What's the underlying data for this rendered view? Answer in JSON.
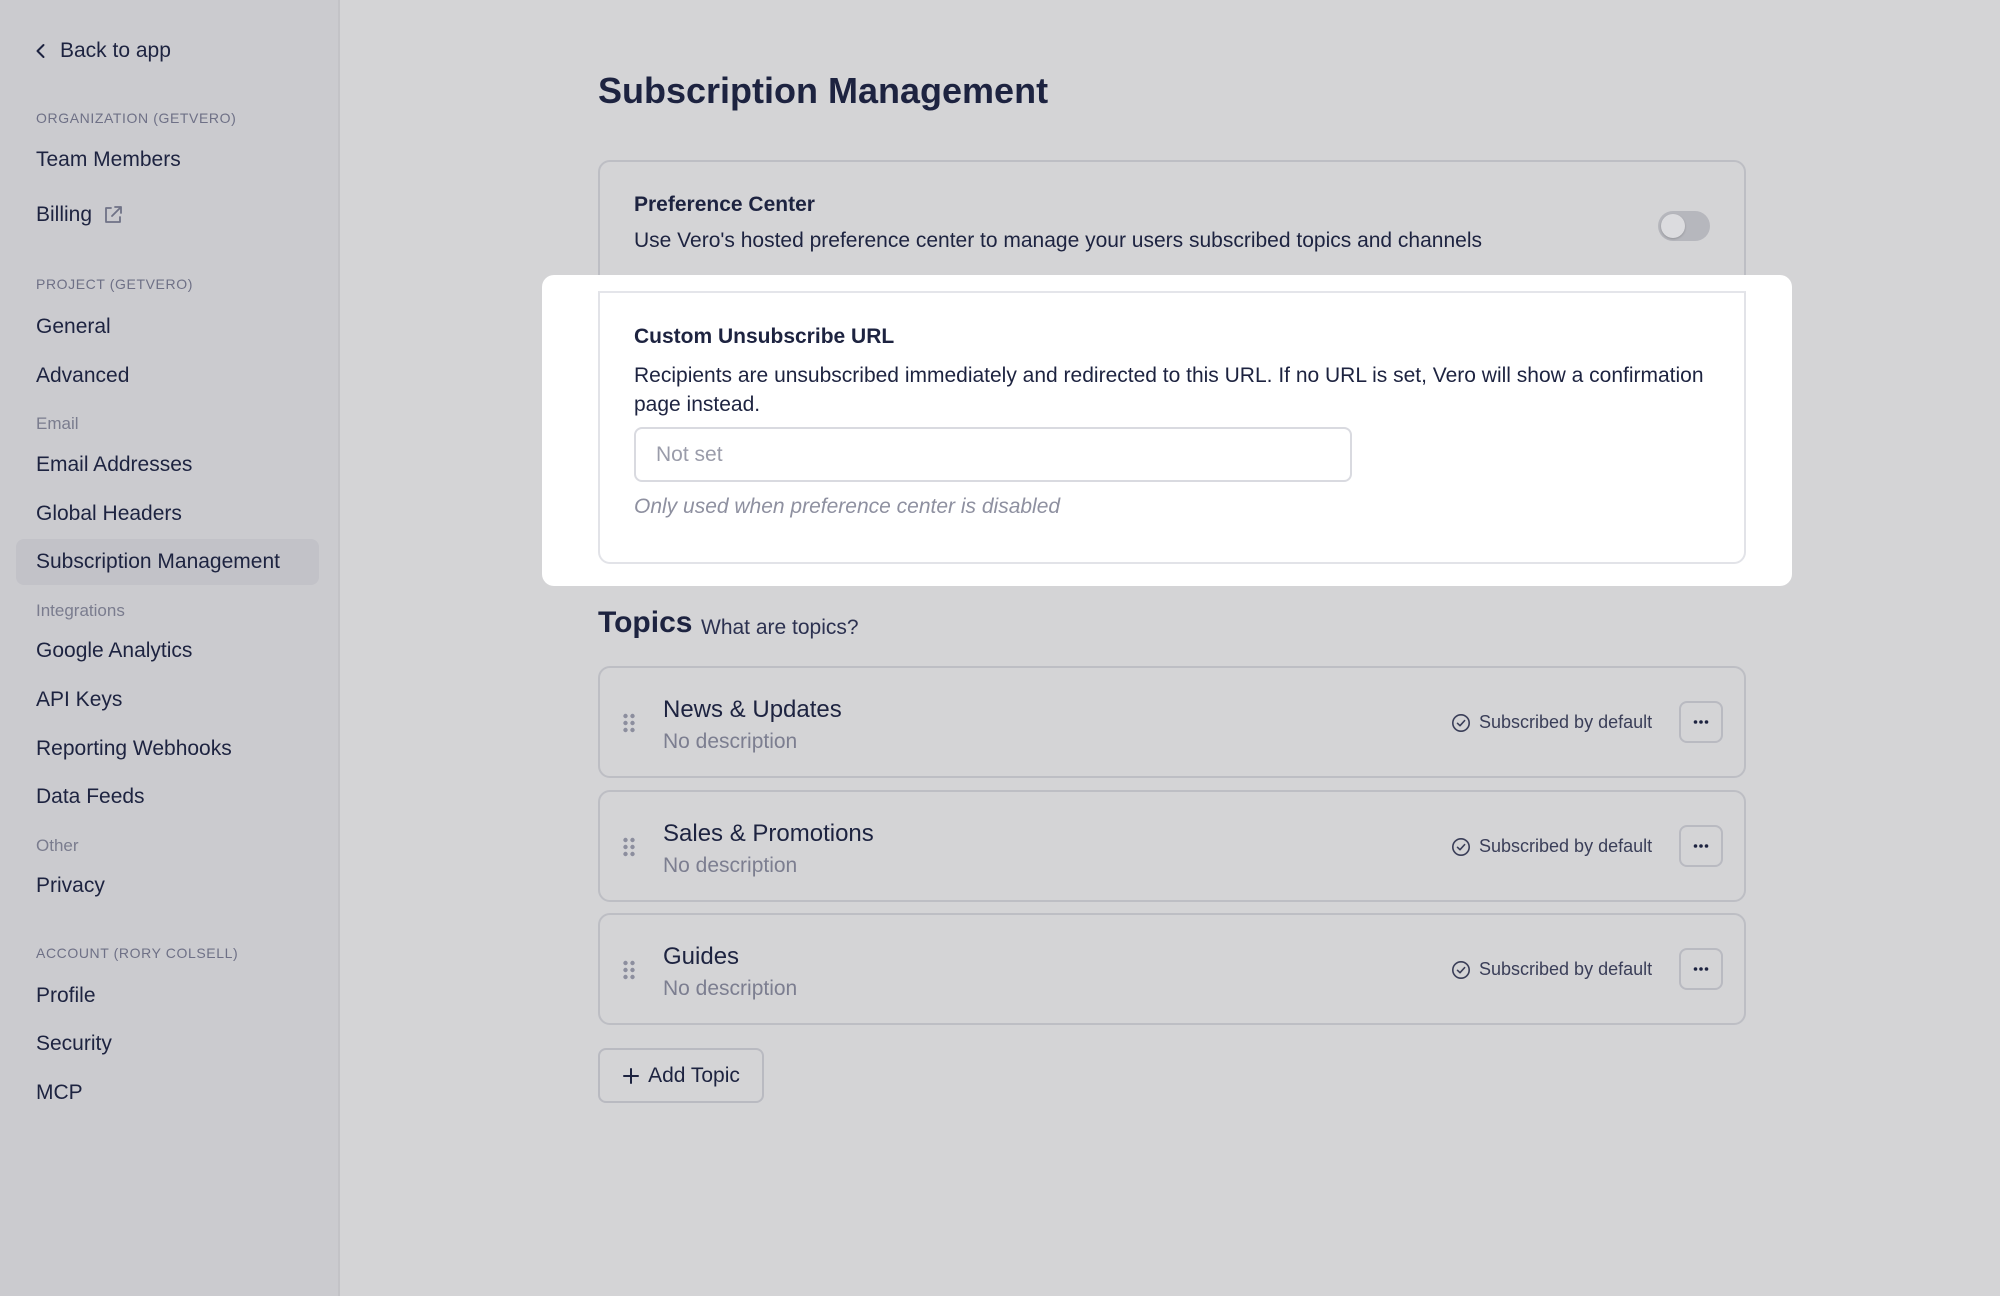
{
  "sidebar": {
    "back_label": "Back to app",
    "sections": {
      "organization": "ORGANIZATION (GETVERO)",
      "project": "PROJECT (GETVERO)",
      "email": "Email",
      "integrations": "Integrations",
      "other": "Other",
      "account": "ACCOUNT (RORY COLSELL)"
    },
    "items": {
      "team_members": "Team Members",
      "billing": "Billing",
      "general": "General",
      "advanced": "Advanced",
      "email_addresses": "Email Addresses",
      "global_headers": "Global Headers",
      "subscription_management": "Subscription Management",
      "google_analytics": "Google Analytics",
      "api_keys": "API Keys",
      "reporting_webhooks": "Reporting Webhooks",
      "data_feeds": "Data Feeds",
      "privacy": "Privacy",
      "profile": "Profile",
      "security": "Security",
      "mcp": "MCP"
    },
    "active_item": "Subscription Management"
  },
  "main": {
    "title": "Subscription Management",
    "preference_center": {
      "title": "Preference Center",
      "description": "Use Vero's hosted preference center to manage your users subscribed topics and channels",
      "enabled": false
    },
    "custom_unsubscribe": {
      "title": "Custom Unsubscribe URL",
      "description": "Recipients are unsubscribed immediately and redirected to this URL. If no URL is set, Vero will show a confirmation page instead.",
      "value": "",
      "placeholder": "Not set",
      "hint": "Only used when preference center is disabled"
    },
    "topics": {
      "heading": "Topics",
      "help_link": "What are topics?",
      "list": [
        {
          "name": "News & Updates",
          "description": "No description",
          "status": "Subscribed by default"
        },
        {
          "name": "Sales & Promotions",
          "description": "No description",
          "status": "Subscribed by default"
        },
        {
          "name": "Guides",
          "description": "No description",
          "status": "Subscribed by default"
        }
      ],
      "add_label": "Add Topic"
    }
  },
  "icons": {
    "back": "chevron-left-icon",
    "billing": "external-link-icon",
    "drag": "drag-handle-icon",
    "subscribed": "check-circle-icon",
    "more": "more-horizontal-icon",
    "add": "plus-icon"
  }
}
